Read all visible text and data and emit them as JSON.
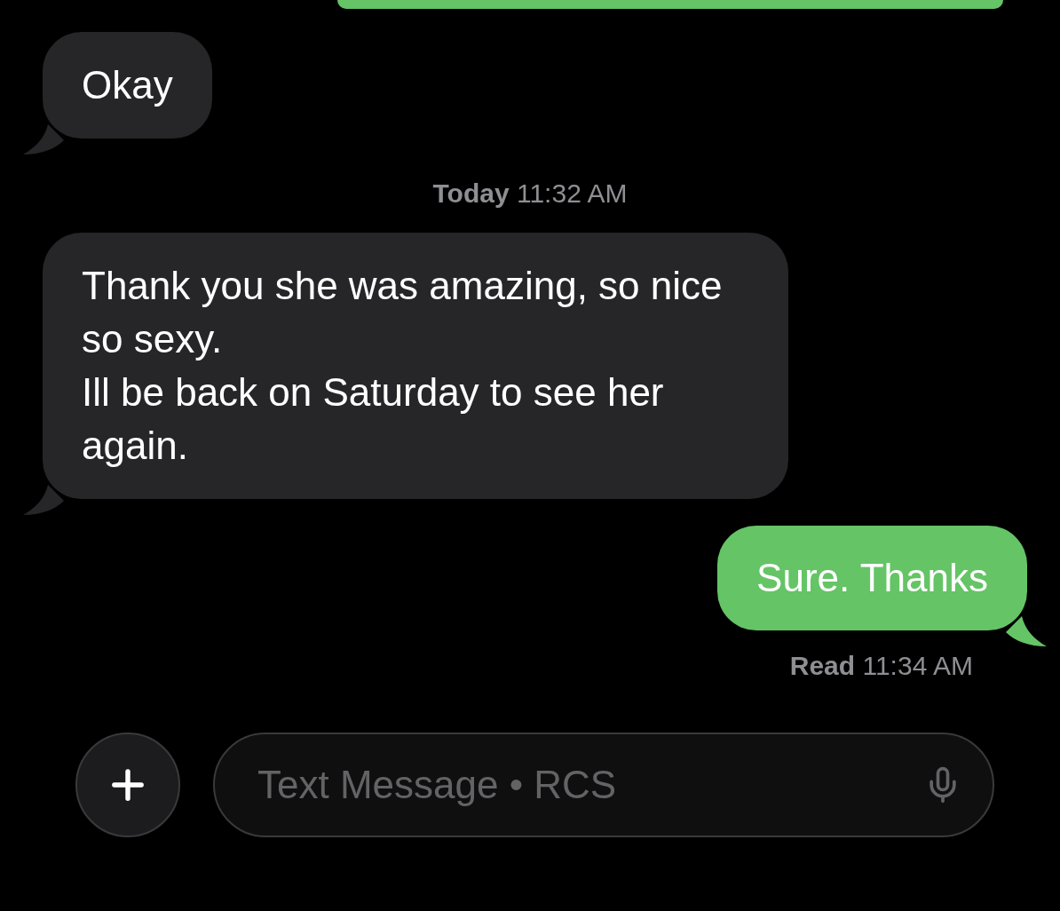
{
  "messages": [
    {
      "kind": "incoming",
      "text": "Okay"
    },
    {
      "kind": "timestamp",
      "label": "Today",
      "time": "11:32 AM"
    },
    {
      "kind": "incoming",
      "text": "Thank you she was amazing, so nice so sexy.\nIll be back on Saturday to see her again."
    },
    {
      "kind": "outgoing",
      "text": "Sure. Thanks"
    },
    {
      "kind": "receipt",
      "label": "Read",
      "time": "11:34 AM"
    }
  ],
  "composer": {
    "placeholder": "Text Message • RCS"
  }
}
